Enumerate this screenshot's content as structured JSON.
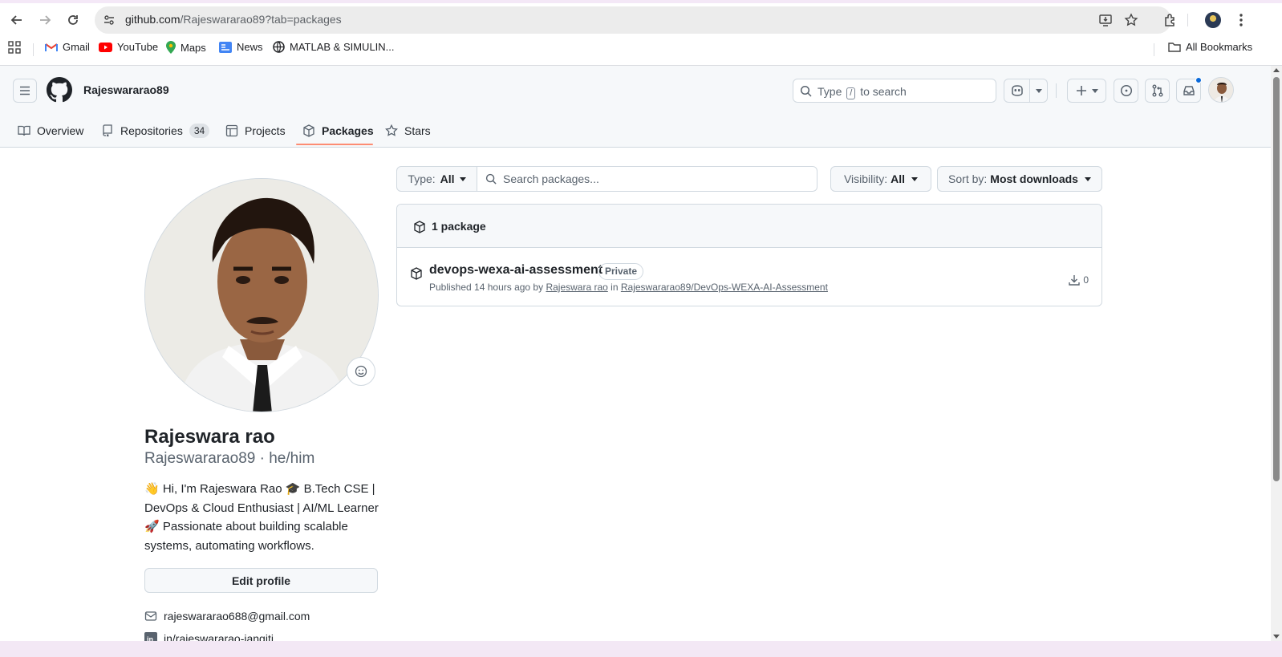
{
  "browser": {
    "url_host": "github.com",
    "url_path": "/Rajeswararao89?tab=packages",
    "bookmarks": [
      {
        "label": "Gmail",
        "icon": "gmail-icon"
      },
      {
        "label": "YouTube",
        "icon": "youtube-icon"
      },
      {
        "label": "Maps",
        "icon": "maps-icon"
      },
      {
        "label": "News",
        "icon": "news-icon"
      },
      {
        "label": "MATLAB & SIMULIN...",
        "icon": "globe-icon"
      }
    ],
    "all_bookmarks": "All Bookmarks"
  },
  "header": {
    "username": "Rajeswararao89",
    "search_prefix": "Type",
    "search_key": "/",
    "search_suffix": "to search"
  },
  "tabs": [
    {
      "label": "Overview",
      "icon": "book-icon"
    },
    {
      "label": "Repositories",
      "icon": "repo-icon",
      "count": "34"
    },
    {
      "label": "Projects",
      "icon": "table-icon"
    },
    {
      "label": "Packages",
      "icon": "package-icon",
      "active": true
    },
    {
      "label": "Stars",
      "icon": "star-icon"
    }
  ],
  "profile": {
    "name": "Rajeswara rao",
    "login_line": "Rajeswararao89 · he/him",
    "bio": "👋 Hi, I'm Rajeswara Rao 🎓 B.Tech CSE | DevOps & Cloud Enthusiast | AI/ML Learner 🚀 Passionate about building scalable systems, automating workflows.",
    "edit_label": "Edit profile",
    "email": "rajeswararao688@gmail.com",
    "linkedin": "in/rajeswararao-jangiti"
  },
  "filters": {
    "type_prefix": "Type:",
    "type_value": "All",
    "search_placeholder": "Search packages...",
    "visibility_prefix": "Visibility:",
    "visibility_value": "All",
    "sort_prefix": "Sort by:",
    "sort_value": "Most downloads"
  },
  "packages": {
    "count_label": "1 package",
    "items": [
      {
        "name": "devops-wexa-ai-assessment",
        "label": "Private",
        "published_prefix": "Published 14 hours ago by",
        "author": "Rajeswara rao",
        "in_text": "in",
        "repo": "Rajeswararao89/DevOps-WEXA-AI-Assessment",
        "downloads": "0"
      }
    ]
  },
  "colors": {
    "accent_underline": "#fd8c73",
    "notification_dot": "#0969da"
  }
}
